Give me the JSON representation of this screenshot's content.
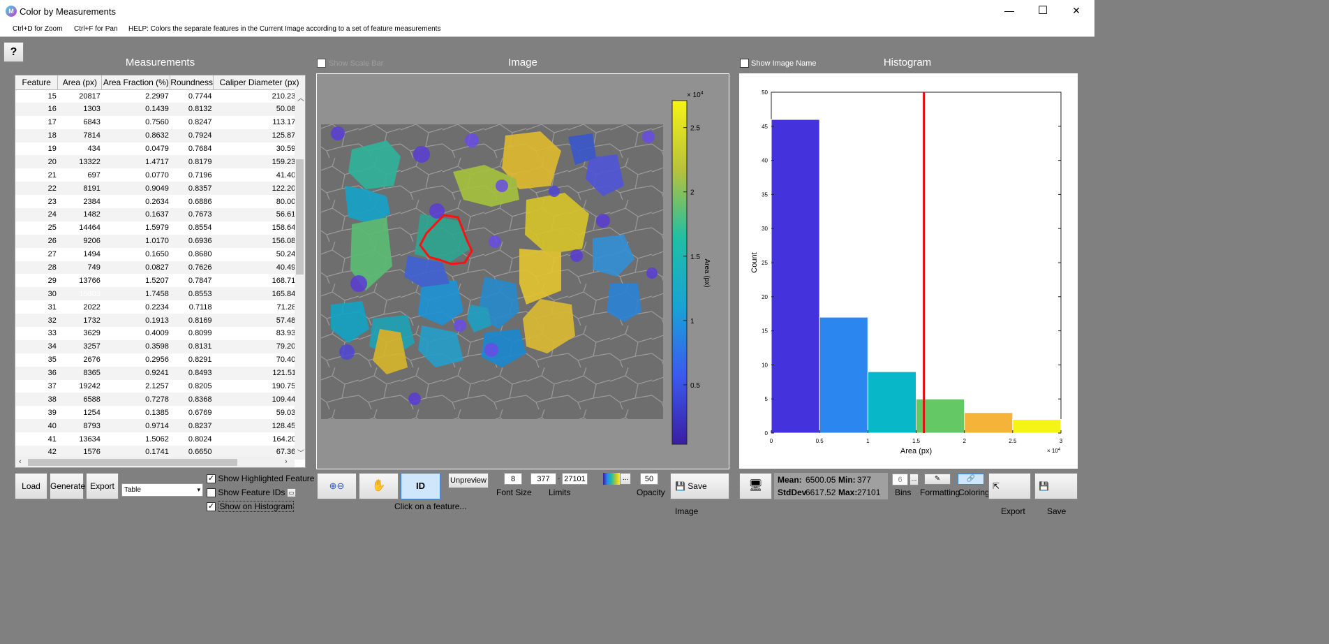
{
  "window": {
    "title": "Color by Measurements",
    "minimize": "—",
    "maximize": "☐",
    "close": "✕",
    "icon": "M"
  },
  "hints": {
    "zoom": "Ctrl+D for Zoom",
    "pan": "Ctrl+F for Pan",
    "help": "HELP:  Colors the separate features in the Current Image according to a set of feature measurements"
  },
  "help_button": "?",
  "measurements": {
    "title": "Measurements",
    "columns": [
      "Feature",
      "Area (px)",
      "Area Fraction (%)",
      "Roundness",
      "Caliper Diameter (px)"
    ],
    "rows": [
      [
        "15",
        "20817",
        "2.2997",
        "0.7744",
        "210.2380"
      ],
      [
        "16",
        "1303",
        "0.1439",
        "0.8132",
        "50.0899"
      ],
      [
        "17",
        "6843",
        "0.7560",
        "0.8247",
        "113.1769"
      ],
      [
        "18",
        "7814",
        "0.8632",
        "0.7924",
        "125.8730"
      ],
      [
        "19",
        "434",
        "0.0479",
        "0.7684",
        "30.5941"
      ],
      [
        "20",
        "13322",
        "1.4717",
        "0.8179",
        "159.2388"
      ],
      [
        "21",
        "697",
        "0.0770",
        "0.7196",
        "41.4005"
      ],
      [
        "22",
        "8191",
        "0.9049",
        "0.8357",
        "122.2007"
      ],
      [
        "23",
        "2384",
        "0.2634",
        "0.6886",
        "80.0063"
      ],
      [
        "24",
        "1482",
        "0.1637",
        "0.7673",
        "56.6127"
      ],
      [
        "25",
        "14464",
        "1.5979",
        "0.8554",
        "158.6474"
      ],
      [
        "26",
        "9206",
        "1.0170",
        "0.6936",
        "156.0833"
      ],
      [
        "27",
        "1494",
        "0.1650",
        "0.8680",
        "50.2494"
      ],
      [
        "28",
        "749",
        "0.0827",
        "0.7626",
        "40.4969"
      ],
      [
        "29",
        "13766",
        "1.5207",
        "0.7847",
        "168.7157"
      ],
      [
        "30",
        "15803",
        "1.7458",
        "0.8553",
        "165.8463"
      ],
      [
        "31",
        "2022",
        "0.2234",
        "0.7118",
        "71.2811"
      ],
      [
        "32",
        "1732",
        "0.1913",
        "0.8169",
        "57.4891"
      ],
      [
        "33",
        "3629",
        "0.4009",
        "0.8099",
        "83.9345"
      ],
      [
        "34",
        "3257",
        "0.3598",
        "0.8131",
        "79.2023"
      ],
      [
        "35",
        "2676",
        "0.2956",
        "0.8291",
        "70.4060"
      ],
      [
        "36",
        "8365",
        "0.9241",
        "0.8493",
        "121.5113"
      ],
      [
        "37",
        "19242",
        "2.1257",
        "0.8205",
        "190.7590"
      ],
      [
        "38",
        "6588",
        "0.7278",
        "0.8368",
        "109.4441"
      ],
      [
        "39",
        "1254",
        "0.1385",
        "0.6769",
        "59.0339"
      ],
      [
        "40",
        "8793",
        "0.9714",
        "0.8237",
        "128.4562"
      ],
      [
        "41",
        "13634",
        "1.5062",
        "0.8024",
        "164.2011"
      ],
      [
        "42",
        "1576",
        "0.1741",
        "0.6650",
        "67.3673"
      ]
    ],
    "selected_feature": "30",
    "buttons": {
      "load": "Load",
      "generate": "Generate",
      "export": "Export"
    },
    "dropdown_value": "Table",
    "checks": {
      "highlighted": "Show Highlighted Feature",
      "ids": "Show Feature IDs",
      "histogram": "Show on Histogram"
    }
  },
  "image": {
    "title": "Image",
    "show_scale_bar": "Show Scale Bar",
    "colorbar_label": "Area (px)",
    "colorbar_exponent": "× 10",
    "colorbar_exp_power": "4",
    "colorbar_ticks": [
      "2.5",
      "2",
      "1.5",
      "1",
      "0.5"
    ],
    "toolbar": {
      "unpreview": "Unpreview",
      "id": "ID",
      "font_size_value": "8",
      "font_size_label": "Font Size",
      "limit_low": "377",
      "limit_dash": "-",
      "limit_high": "27101",
      "limits_label": "Limits",
      "ellipsis": "...",
      "opacity_value": "50",
      "opacity_label": "Opacity",
      "save_image": "Save Image",
      "status": "Click on a feature..."
    }
  },
  "histogram": {
    "show_image_name": "Show Image Name",
    "title": "Histogram",
    "stats": {
      "mean_label": "Mean:",
      "mean": "6500.05",
      "min_label": "Min:",
      "min": "377",
      "stddev_label": "StdDev",
      "stddev": "6617.52",
      "max_label": "Max:",
      "max": "27101"
    },
    "bins_value": "6",
    "bins_label": "Bins",
    "formatting_label": "Formatting",
    "coloring_label": "Coloring",
    "export": "Export",
    "save": "Save"
  },
  "chart_data": {
    "type": "bar",
    "xlabel": "Area (px)",
    "ylabel": "Count",
    "x_exponent": "× 10",
    "x_exp_power": "4",
    "xlim": [
      0,
      3
    ],
    "ylim": [
      0,
      50
    ],
    "xticks": [
      "0",
      "0.5",
      "1",
      "1.5",
      "2",
      "2.5",
      "3"
    ],
    "yticks": [
      "0",
      "5",
      "10",
      "15",
      "20",
      "25",
      "30",
      "35",
      "40",
      "45",
      "50"
    ],
    "bins": [
      {
        "start": 0,
        "end": 0.5,
        "count": 46,
        "color": "#4433dd"
      },
      {
        "start": 0.5,
        "end": 1,
        "count": 17,
        "color": "#2b86f0"
      },
      {
        "start": 1,
        "end": 1.5,
        "count": 9,
        "color": "#08b8c8"
      },
      {
        "start": 1.5,
        "end": 2,
        "count": 5,
        "color": "#64c864"
      },
      {
        "start": 2,
        "end": 2.5,
        "count": 3,
        "color": "#f6b33a"
      },
      {
        "start": 2.5,
        "end": 3,
        "count": 2,
        "color": "#f4f417"
      }
    ],
    "marker_value": 1.5803,
    "marker_color": "#e01010"
  }
}
